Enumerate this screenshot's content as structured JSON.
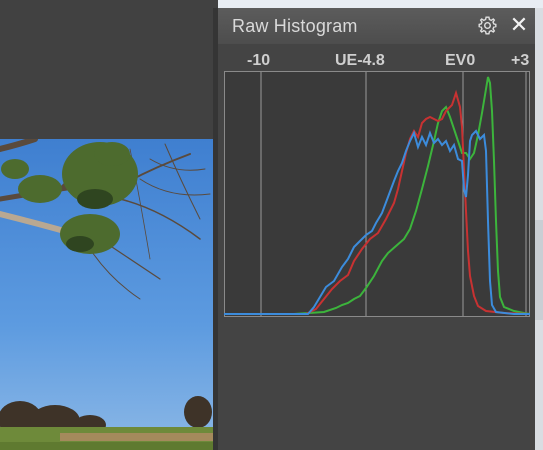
{
  "panel": {
    "title": "Raw Histogram",
    "settings_icon": "gear-icon",
    "close_glyph": "✕"
  },
  "histogram": {
    "axis_labels": [
      "-10",
      "UE-4.8",
      "EV0",
      "+3"
    ],
    "colors": {
      "red": "#c83232",
      "green": "#3cb43c",
      "blue": "#3c8cdc",
      "background": "#3a3a3a",
      "grid": "#9a9a9a"
    }
  }
}
